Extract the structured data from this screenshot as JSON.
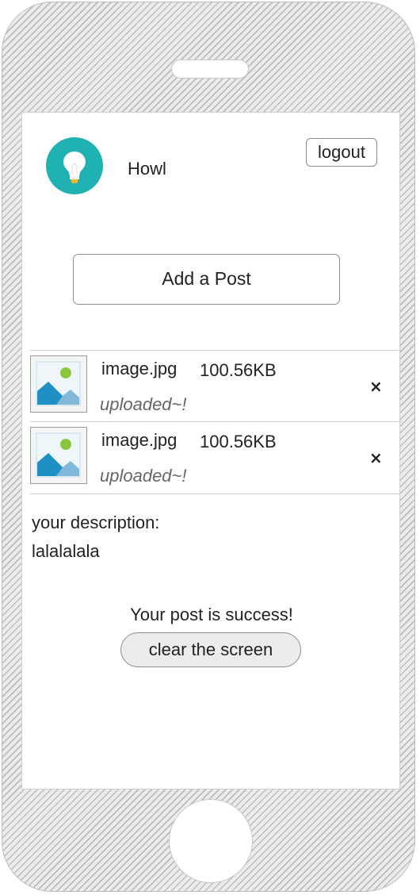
{
  "header": {
    "logo_icon": "lightbulb-icon",
    "logo_color": "#20b2b2",
    "app_title": "Howl",
    "logout_label": "logout"
  },
  "add_post": {
    "label": "Add a Post"
  },
  "files": [
    {
      "icon": "image-icon",
      "name": "image.jpg",
      "size": "100.56KB",
      "status": "uploaded~!",
      "remove_label": "×"
    },
    {
      "icon": "image-icon",
      "name": "image.jpg",
      "size": "100.56KB",
      "status": "uploaded~!",
      "remove_label": "×"
    }
  ],
  "description": {
    "label": "your description:",
    "value": "lalalalala"
  },
  "result": {
    "message": "Your post is success!",
    "clear_label": "clear the screen"
  }
}
